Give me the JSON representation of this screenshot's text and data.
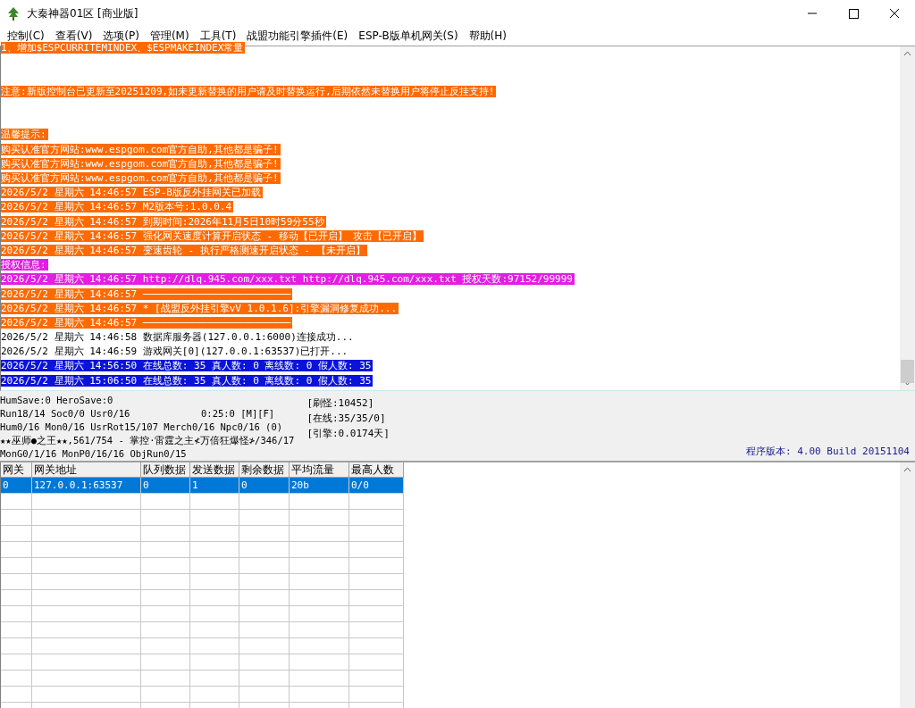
{
  "window": {
    "title": "大秦神器01区 [商业版]"
  },
  "menu": [
    {
      "label": "控制(C)"
    },
    {
      "label": "查看(V)"
    },
    {
      "label": "选项(P)"
    },
    {
      "label": "管理(M)"
    },
    {
      "label": "工具(T)"
    },
    {
      "label": "战盟功能引擎插件(E)"
    },
    {
      "label": "ESP-B版单机网关(S)"
    },
    {
      "label": "帮助(H)"
    }
  ],
  "log": [
    {
      "kind": "text",
      "text": "1、增加$ESPCURRITEMINDEX、$ESPMAKEINDEX常量",
      "color": "#ff6a00"
    },
    {
      "kind": "blank"
    },
    {
      "kind": "blank"
    },
    {
      "kind": "text",
      "text": "注意:新版控制台已更新至20251209,如未更新替换的用户请及时替换运行,后期依然未替换用户将停止反挂支持!",
      "color": "#ff6a00"
    },
    {
      "kind": "blank"
    },
    {
      "kind": "blank"
    },
    {
      "kind": "text",
      "text": "温馨提示:",
      "color": "#ff6a00"
    },
    {
      "kind": "text",
      "text": "购买认准官方网站:www.espgom.com官方自助,其他都是骗子!",
      "color": "#ff6a00"
    },
    {
      "kind": "text",
      "text": "购买认准官方网站:www.espgom.com官方自助,其他都是骗子!",
      "color": "#ff6a00"
    },
    {
      "kind": "text",
      "text": "购买认准官方网站:www.espgom.com官方自助,其他都是骗子!",
      "color": "#ff6a00"
    },
    {
      "kind": "text",
      "text": "2026/5/2 星期六 14:46:57 ESP-B版反外挂网关已加载",
      "color": "#ff6a00"
    },
    {
      "kind": "text",
      "text": "2026/5/2 星期六 14:46:57 M2版本号:1.0.0.4",
      "color": "#ff6a00"
    },
    {
      "kind": "text",
      "text": "2026/5/2 星期六 14:46:57 到期时间:2026年11月5日10时59分55秒",
      "color": "#ff6a00"
    },
    {
      "kind": "text",
      "text": "2026/5/2 星期六 14:46:57 强化网关速度计算开启状态 - 移动【已开启】 攻击【已开启】",
      "color": "#ff6a00"
    },
    {
      "kind": "text",
      "text": "2026/5/2 星期六 14:46:57 变速齿轮 - 执行严格测速开启状态 - 【未开启】",
      "color": "#ff6a00"
    },
    {
      "kind": "text",
      "text": "授权信息:",
      "color": "#e21ee2"
    },
    {
      "kind": "text",
      "text": "2026/5/2 星期六 14:46:57 http://dlq.945.com/xxx.txt http://dlq.945.com/xxx.txt 授权天数:97152/99999",
      "color": "#e21ee2"
    },
    {
      "kind": "text",
      "text": "2026/5/2 星期六 14:46:57 ─────────────────────────",
      "color": "#ff6a00"
    },
    {
      "kind": "text",
      "text": "2026/5/2 星期六 14:46:57 * [战盟反外挂引擎vV 1.0.1.6]:引擎漏洞修复成功...",
      "color": "#ff6a00"
    },
    {
      "kind": "text",
      "text": "2026/5/2 星期六 14:46:57 ─────────────────────────",
      "color": "#ff6a00"
    },
    {
      "kind": "text",
      "text": "2026/5/2 星期六 14:46:58 数据库服务器(127.0.0.1:6000)连接成功..."
    },
    {
      "kind": "text",
      "text": "2026/5/2 星期六 14:46:59 游戏网关[0](127.0.0.1:63537)已打开..."
    },
    {
      "kind": "text",
      "text": "2026/5/2 星期六 14:56:50 在线总数: 35 真人数: 0 离线数: 0 假人数: 35",
      "color": "#0a14d8"
    },
    {
      "kind": "text",
      "text": "2026/5/2 星期六 15:06:50 在线总数: 35 真人数: 0 离线数: 0 假人数: 35",
      "color": "#0a14d8"
    }
  ],
  "status": {
    "lines": [
      "HumSave:0 HeroSave:0",
      "Run18/14 Soc0/0 Usr0/16",
      "Hum0/16 Mon0/16 UsrRot15/107 Merch0/16 Npc0/16 (0)",
      "★★巫师●之王★★,561/754 - 掌控·雷霆之主≮万倍狂爆怪≯/346/17",
      "MonG0/1/16 MonP0/16/16 ObjRun0/15"
    ],
    "timer": "0:25:0 [M][F]",
    "counters": [
      "[刷怪:10452]",
      "[在线:35/35/0]",
      "[引擎:0.0174天]"
    ],
    "version": "程序版本: 4.00 Build 20151104"
  },
  "table": {
    "columns": [
      "网关",
      "网关地址",
      "队列数据",
      "发送数据",
      "剩余数据",
      "平均流量",
      "最高人数"
    ],
    "rows": [
      {
        "selected": true,
        "cells": [
          "0",
          "127.0.0.1:63537",
          "0",
          "1",
          "0",
          "20b",
          "0/0"
        ]
      }
    ]
  }
}
